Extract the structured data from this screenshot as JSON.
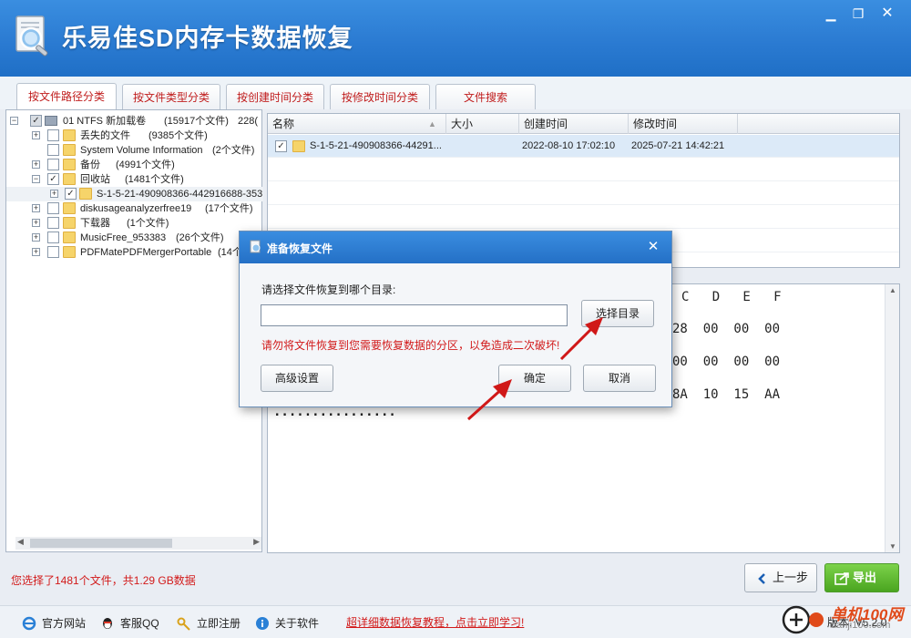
{
  "app": {
    "title": "乐易佳SD内存卡数据恢复"
  },
  "window_controls": {
    "minimize": "▁",
    "maximize": "❐",
    "close": "✕"
  },
  "tabs": [
    {
      "label": "按文件路径分类",
      "active": true
    },
    {
      "label": "按文件类型分类",
      "active": false
    },
    {
      "label": "按创建时间分类",
      "active": false
    },
    {
      "label": "按修改时间分类",
      "active": false
    },
    {
      "label": "文件搜索",
      "active": false
    }
  ],
  "tree": [
    {
      "label": "01  NTFS  新加载卷",
      "count": "(15917个文件)",
      "extra": "228(",
      "icon": "drive-icon",
      "checked": "partial"
    },
    {
      "label": "丢失的文件",
      "count": "(9385个文件)",
      "icon": "folder-icon",
      "checked": "none"
    },
    {
      "label": "System Volume Information",
      "count": "(2个文件)",
      "icon": "folder-icon",
      "checked": "none"
    },
    {
      "label": "备份",
      "count": "(4991个文件)",
      "icon": "folder-icon",
      "checked": "none"
    },
    {
      "label": "回收站",
      "count": "(1481个文件)",
      "icon": "folder-icon",
      "checked": "checked"
    },
    {
      "label": "S-1-5-21-490908366-442916688-353",
      "count": "",
      "icon": "folder-icon",
      "checked": "checked"
    },
    {
      "label": "diskusageanalyzerfree19",
      "count": "(17个文件)",
      "icon": "folder-icon",
      "checked": "none"
    },
    {
      "label": "下载器",
      "count": "(1个文件)",
      "icon": "folder-icon",
      "checked": "none"
    },
    {
      "label": "MusicFree_953383",
      "count": "(26个文件)",
      "icon": "folder-icon",
      "checked": "none"
    },
    {
      "label": "PDFMatePDFMergerPortable",
      "count": "(14个",
      "icon": "folder-icon",
      "checked": "none"
    }
  ],
  "file_list": {
    "columns": [
      "名称",
      "大小",
      "创建时间",
      "修改时间"
    ],
    "rows": [
      {
        "name": "S-1-5-21-490908366-44291...",
        "size": "",
        "created": "2022-08-10  17:02:10",
        "modified": "2025-07-21  14:42:21",
        "checked": true
      }
    ]
  },
  "hex": {
    "header": "C   D   E   F",
    "lines": [
      "28  00  00  00",
      "00  00  00  00",
      "8A  10  15  AA"
    ],
    "dots": "................"
  },
  "dialog": {
    "title": "准备恢复文件",
    "prompt": "请选择文件恢复到哪个目录:",
    "input_value": "",
    "choose_dir_button": "选择目录",
    "warning": "请勿将文件恢复到您需要恢复数据的分区，以免造成二次破坏!",
    "advanced_button": "高级设置",
    "ok_button": "确定",
    "cancel_button": "取消",
    "close_glyph": "✕"
  },
  "status": {
    "selection": "您选择了1481个文件，共1.29 GB数据"
  },
  "nav": {
    "back_label": "上一步",
    "export_label": "导出"
  },
  "footer": {
    "website": "官方网站",
    "qq": "客服QQ",
    "register": "立即注册",
    "about": "关于软件",
    "tutorial": "超详细数据恢复教程，点击立即学习!",
    "version": "版本: V5.2.0"
  },
  "watermark": {
    "line1": "单机100网",
    "line2": "danji100.com"
  },
  "colors": {
    "title_blue": "#2b7bd2",
    "accent_red": "#d21a1a",
    "export_green": "#4aa520",
    "arrow_red": "#d01818"
  }
}
